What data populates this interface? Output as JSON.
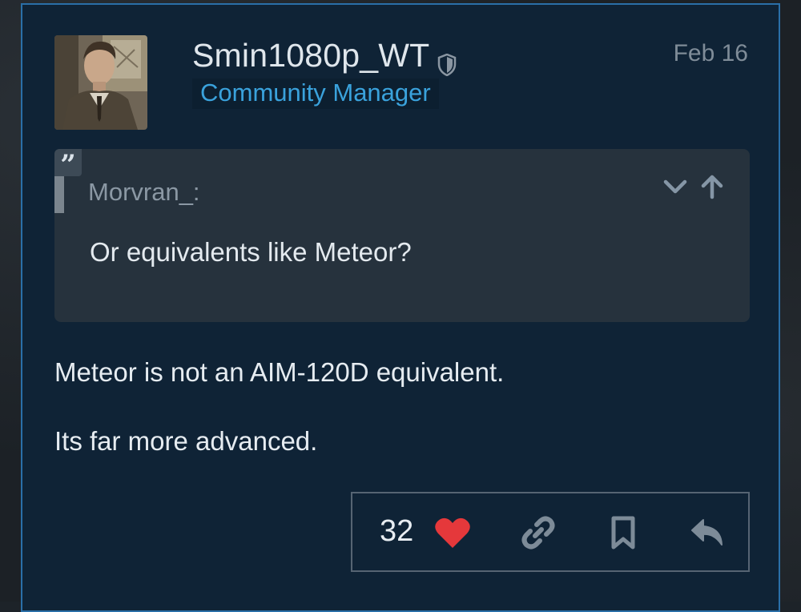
{
  "post": {
    "author": {
      "username": "Smin1080p_WT",
      "title": "Community Manager",
      "avatar": "avatar-image"
    },
    "date": "Feb 16",
    "quote": {
      "author": "Morvran_:",
      "text": "Or equivalents like Meteor?",
      "icons": [
        "quote-icon",
        "chevron-down-icon",
        "arrow-up-icon"
      ]
    },
    "body": [
      "Meteor is not an AIM-120D equivalent.",
      "Its far more advanced."
    ],
    "actions": {
      "like_count": "32",
      "icons": [
        "heart-icon",
        "link-icon",
        "bookmark-icon",
        "reply-icon"
      ]
    }
  },
  "colors": {
    "background": "#0f2336",
    "border": "#2a6fa8",
    "accent": "#3aa2dc",
    "heart": "#e5383b",
    "quote_bg": "#26323d"
  }
}
